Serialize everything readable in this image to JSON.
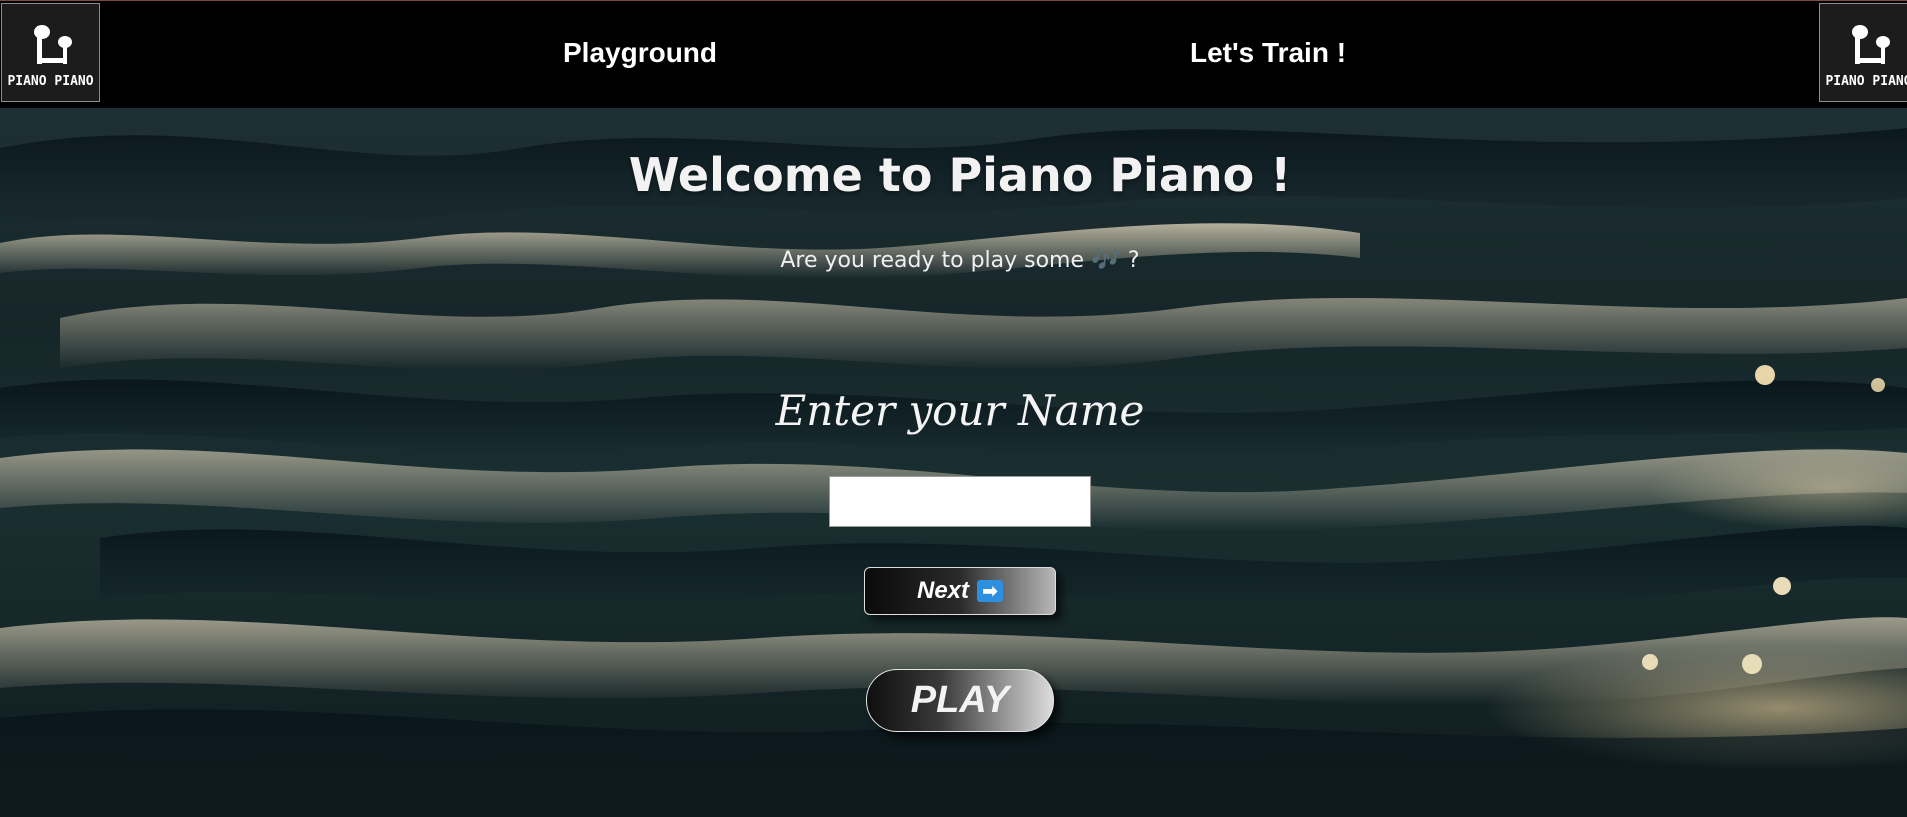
{
  "header": {
    "logo_text": "PIANO PIANO",
    "nav": [
      {
        "label": "Playground"
      },
      {
        "label": "Let's Train !"
      }
    ]
  },
  "main": {
    "title": "Welcome to Piano Piano !",
    "subtitle_text": "Are you ready to play some",
    "subtitle_emoji": "🎶",
    "subtitle_end": "?",
    "name_label": "Enter your Name",
    "name_input_value": "",
    "next_label": "Next",
    "next_icon": "➡",
    "play_label": "PLAY"
  },
  "colors": {
    "navbar": "#000000",
    "accent_arrow": "#2d8fe0"
  }
}
